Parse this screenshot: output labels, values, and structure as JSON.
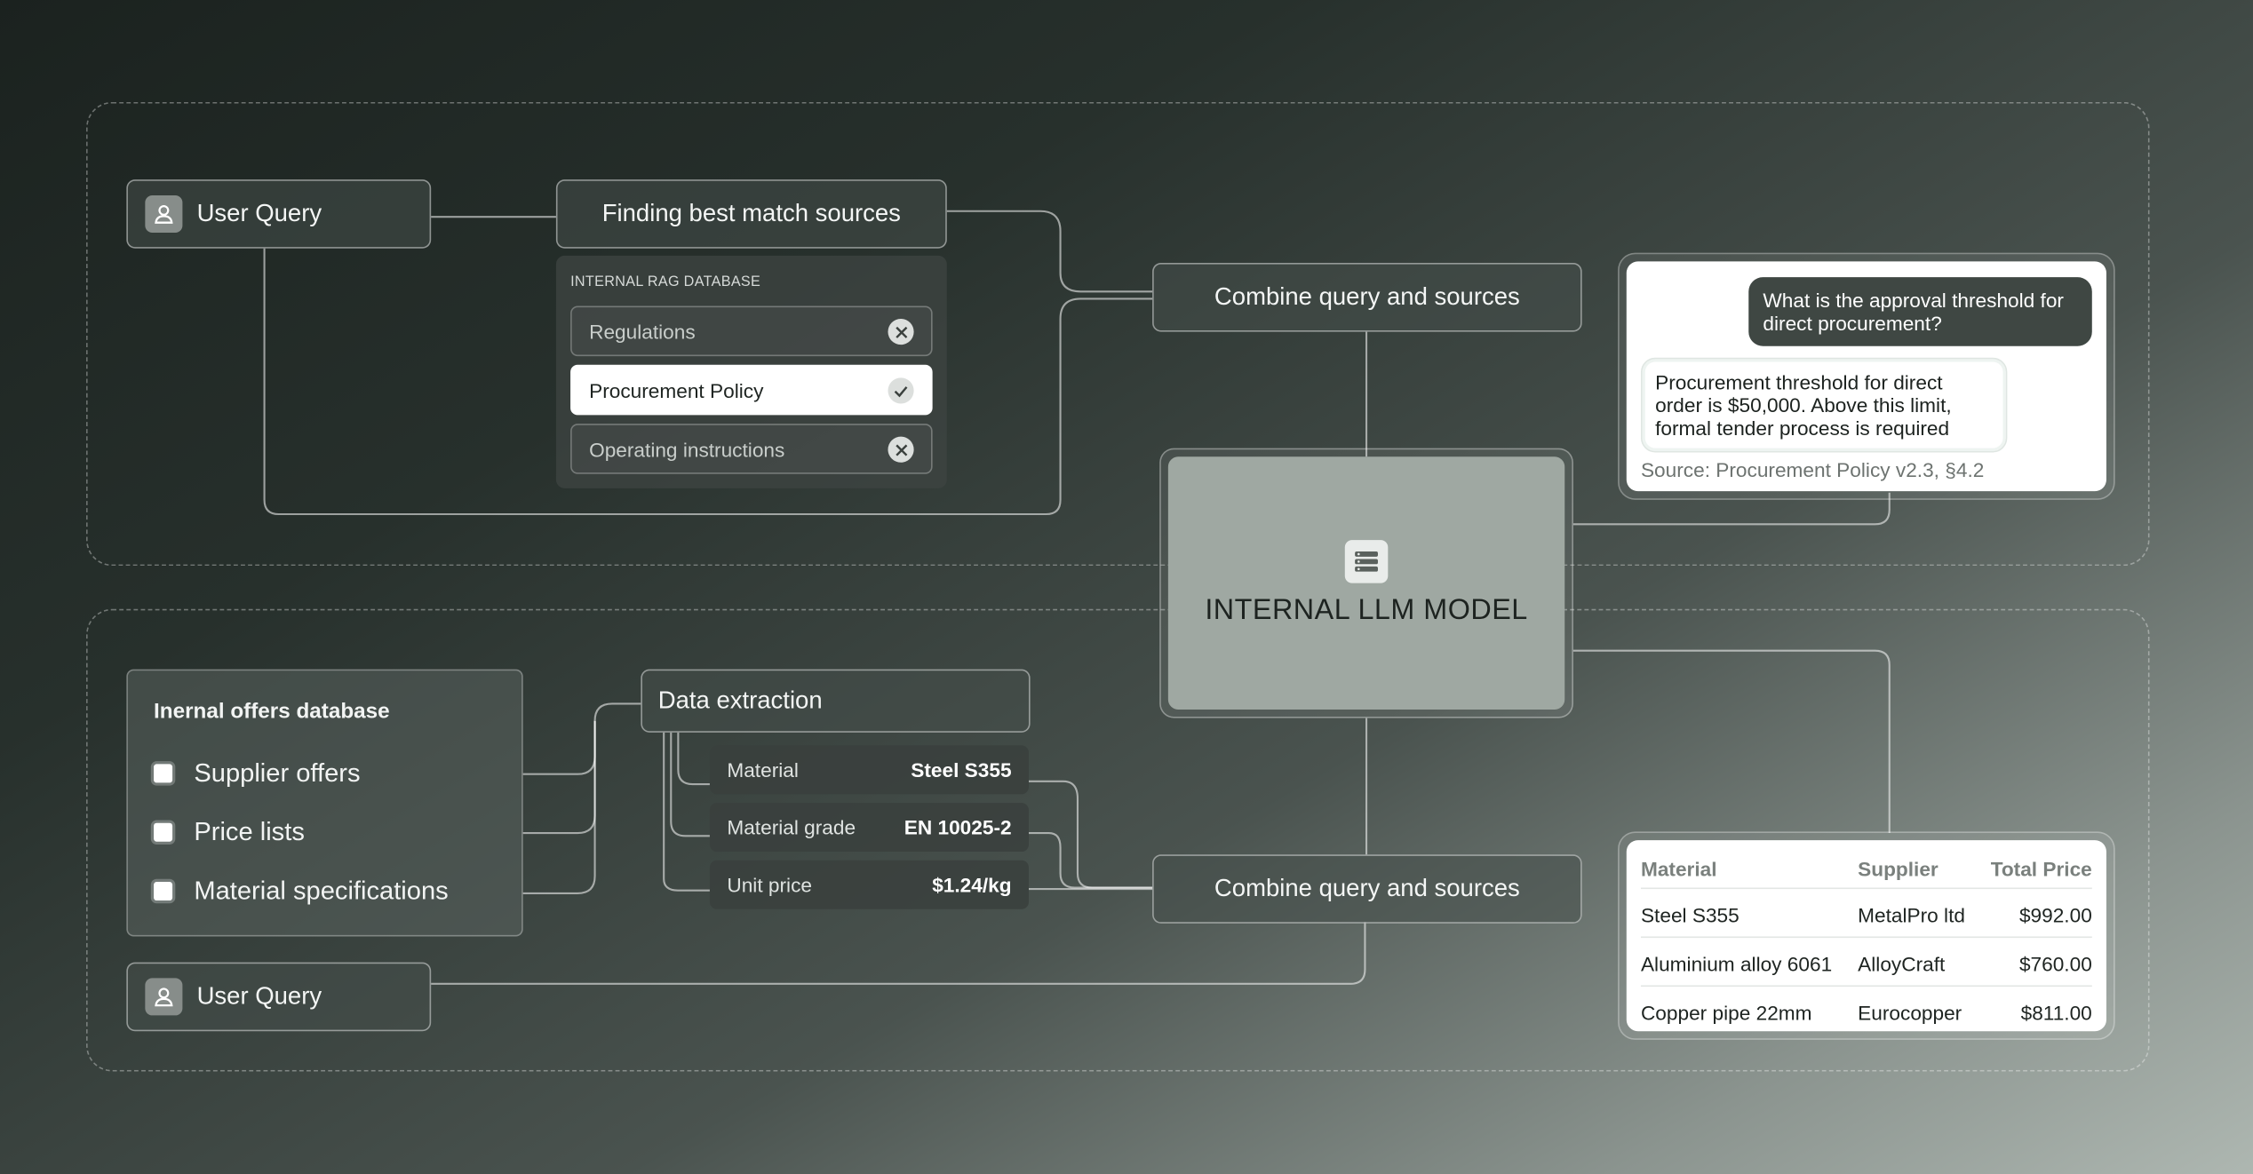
{
  "top_flow": {
    "user_query": "User Query",
    "finding_sources": "Finding best match sources",
    "database_caption": "INTERNAL RAG DATABASE",
    "sources": [
      {
        "label": "Regulations",
        "selected": false
      },
      {
        "label": "Procurement Policy",
        "selected": true
      },
      {
        "label": "Operating instructions",
        "selected": false
      }
    ],
    "combine": "Combine query and sources"
  },
  "llm": {
    "label": "INTERNAL LLM MODEL",
    "icon": "database-icon"
  },
  "chat": {
    "question": "What is the approval threshold for direct procurement?",
    "answer": "Procurement threshold for direct order is $50,000. Above this limit, formal tender process is required",
    "source": "Source: Procurement Policy v2.3, §4.2"
  },
  "bottom_flow": {
    "offers_title": "Inernal offers database",
    "offers_items": [
      "Supplier offers",
      "Price lists",
      "Material specifications"
    ],
    "user_query": "User Query",
    "extraction_title": "Data extraction",
    "extraction_rows": [
      {
        "label": "Material",
        "value": "Steel S355"
      },
      {
        "label": "Material grade",
        "value": "EN 10025-2"
      },
      {
        "label": "Unit price",
        "value": "$1.24/kg"
      }
    ],
    "combine": "Combine query and sources"
  },
  "result_table": {
    "headers": [
      "Material",
      "Supplier",
      "Total Price"
    ],
    "rows": [
      [
        "Steel S355",
        "MetalPro ltd",
        "$992.00"
      ],
      [
        "Aluminium alloy 6061",
        "AlloyCraft",
        "$760.00"
      ],
      [
        "Copper pipe 22mm",
        "Eurocopper",
        "$811.00"
      ]
    ]
  }
}
